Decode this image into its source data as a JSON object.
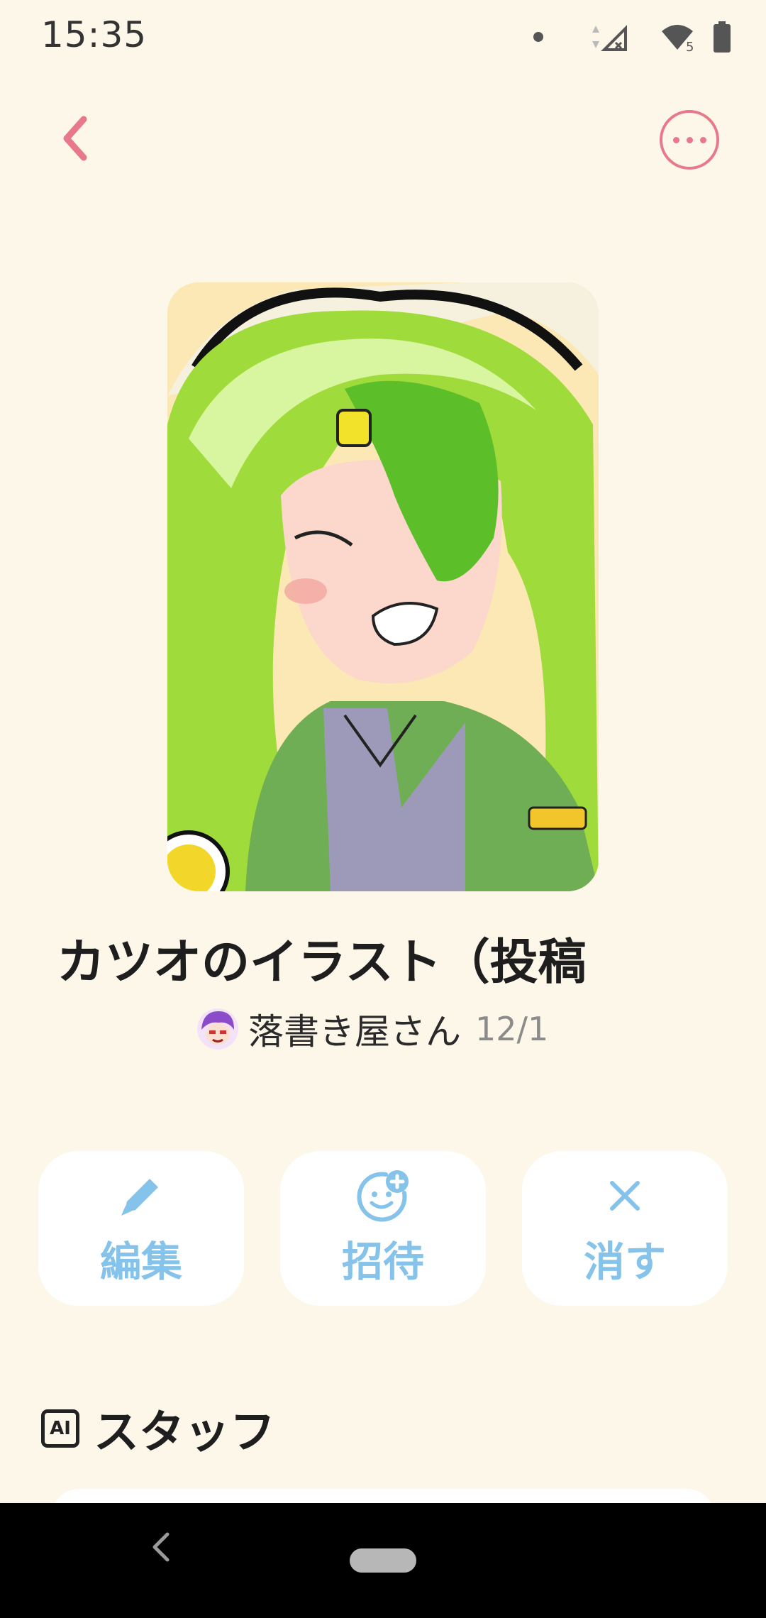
{
  "status_bar": {
    "time": "15:35",
    "icons": [
      "notification-dot-icon",
      "data-arrows-icon",
      "signal-off-icon",
      "wifi-icon",
      "battery-icon"
    ],
    "wifi_badge": "5"
  },
  "header": {
    "back_icon": "chevron-left-icon",
    "more_icon": "more-horizontal-icon",
    "accent_color": "#e8788b"
  },
  "post": {
    "title": "カツオのイラスト（投稿",
    "author": "落書き屋さん",
    "date": "12/1"
  },
  "actions": [
    {
      "label": "編集",
      "icon": "pencil-icon"
    },
    {
      "label": "招待",
      "icon": "invite-face-plus-icon"
    },
    {
      "label": "消す",
      "icon": "close-x-icon"
    }
  ],
  "actions_color": "#86c3ea",
  "staff_section": {
    "badge": "AI",
    "title": "スタッフ"
  },
  "nav": {
    "back_icon": "nav-back-icon",
    "home_icon": "home-pill-icon"
  }
}
